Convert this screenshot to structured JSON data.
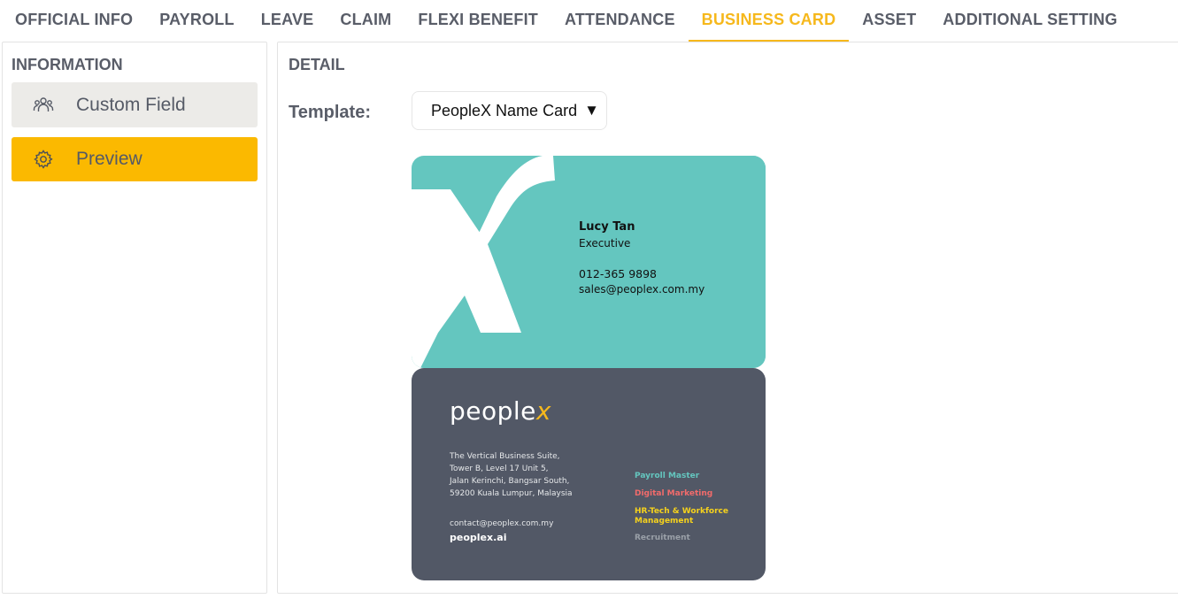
{
  "tabs": [
    {
      "label": "OFFICIAL INFO",
      "active": false
    },
    {
      "label": "PAYROLL",
      "active": false
    },
    {
      "label": "LEAVE",
      "active": false
    },
    {
      "label": "CLAIM",
      "active": false
    },
    {
      "label": "FLEXI BENEFIT",
      "active": false
    },
    {
      "label": "ATTENDANCE",
      "active": false
    },
    {
      "label": "BUSINESS CARD",
      "active": true
    },
    {
      "label": "ASSET",
      "active": false
    },
    {
      "label": "ADDITIONAL SETTING",
      "active": false
    }
  ],
  "sidebar": {
    "heading": "INFORMATION",
    "items": [
      {
        "label": "Custom Field",
        "icon": "users-icon",
        "active": false
      },
      {
        "label": "Preview",
        "icon": "gear-icon",
        "active": true
      }
    ]
  },
  "detail": {
    "heading": "DETAIL",
    "template_label": "Template:",
    "template_value": "PeopleX Name Card",
    "template_caret": "▼"
  },
  "card_front": {
    "name": "Lucy Tan",
    "title": "Executive",
    "phone": "012-365 9898",
    "email": "sales@peoplex.com.my"
  },
  "card_back": {
    "brand_main": "people",
    "brand_x": "x",
    "address": [
      "The Vertical Business Suite,",
      "Tower B, Level 17 Unit 5,",
      "Jalan Kerinchi, Bangsar South,",
      "59200 Kuala Lumpur, Malaysia"
    ],
    "contact": "contact@peoplex.com.my",
    "website": "peoplex.ai",
    "services": [
      "Payroll Master",
      "Digital Marketing",
      "HR-Tech & Workforce Management",
      "Recruitment"
    ]
  },
  "colors": {
    "accent": "#f6b81c",
    "card_teal": "#64c6bf",
    "card_dark": "#525866",
    "menu_active": "#fbb900",
    "menu_idle": "#ecebe8"
  }
}
